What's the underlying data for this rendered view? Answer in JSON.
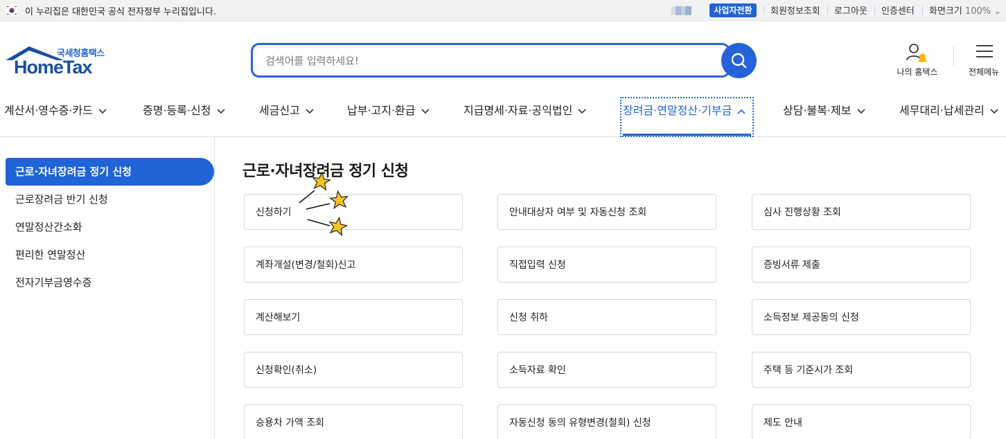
{
  "gov_bar": {
    "text": "이 누리집은 대한민국 공식 전자정부 누리집입니다.",
    "switch_label": "사업자전환",
    "links": [
      "회원정보조회",
      "로그아웃",
      "인증센터"
    ],
    "zoom_label": "화면크기",
    "zoom_value": "100%",
    "zoom_arrow": "⌄"
  },
  "logo": {
    "sub": "국세청홈택스",
    "main": "HomeTax"
  },
  "search": {
    "placeholder": "검색어를 입력하세요!",
    "value": ""
  },
  "header": {
    "my_home": "나의 홈택스",
    "all_menu": "전체메뉴"
  },
  "gnb": [
    "계산서·영수증·카드",
    "증명·등록·신청",
    "세금신고",
    "납부·고지·환급",
    "지급명세·자료·공익법인",
    "장려금·연말정산·기부금",
    "상담·불복·제보",
    "세무대리·납세관리"
  ],
  "gnb_active_index": 5,
  "sidebar": [
    "근로·자녀장려금 정기 신청",
    "근로장려금 반기 신청",
    "연말정산간소화",
    "편리한 연말정산",
    "전자기부금영수증"
  ],
  "sidebar_active_index": 0,
  "main": {
    "title": "근로·자녀장려금 정기 신청",
    "cards": [
      "신청하기",
      "안내대상자 여부 및 자동신청 조회",
      "심사 진행상황 조회",
      "계좌개설(변경/철회)신고",
      "직접입력 신청",
      "증빙서류 제출",
      "계산해보기",
      "신청 취하",
      "소득정보 제공동의 신청",
      "신청확인(취소)",
      "소득자료 확인",
      "주택 등 기준시가 조회",
      "승용차 가액 조회",
      "자동신청 동의 유형변경(철회) 신청",
      "제도 안내"
    ]
  },
  "colors": {
    "accent": "#1f63d6",
    "logo": "#1b4ea3",
    "star": "#f7c325"
  },
  "icons": [
    "korea-flag-icon",
    "search-icon",
    "user-bell-icon",
    "hamburger-icon",
    "chevron-down-icon",
    "chevron-up-icon",
    "star-icon"
  ]
}
